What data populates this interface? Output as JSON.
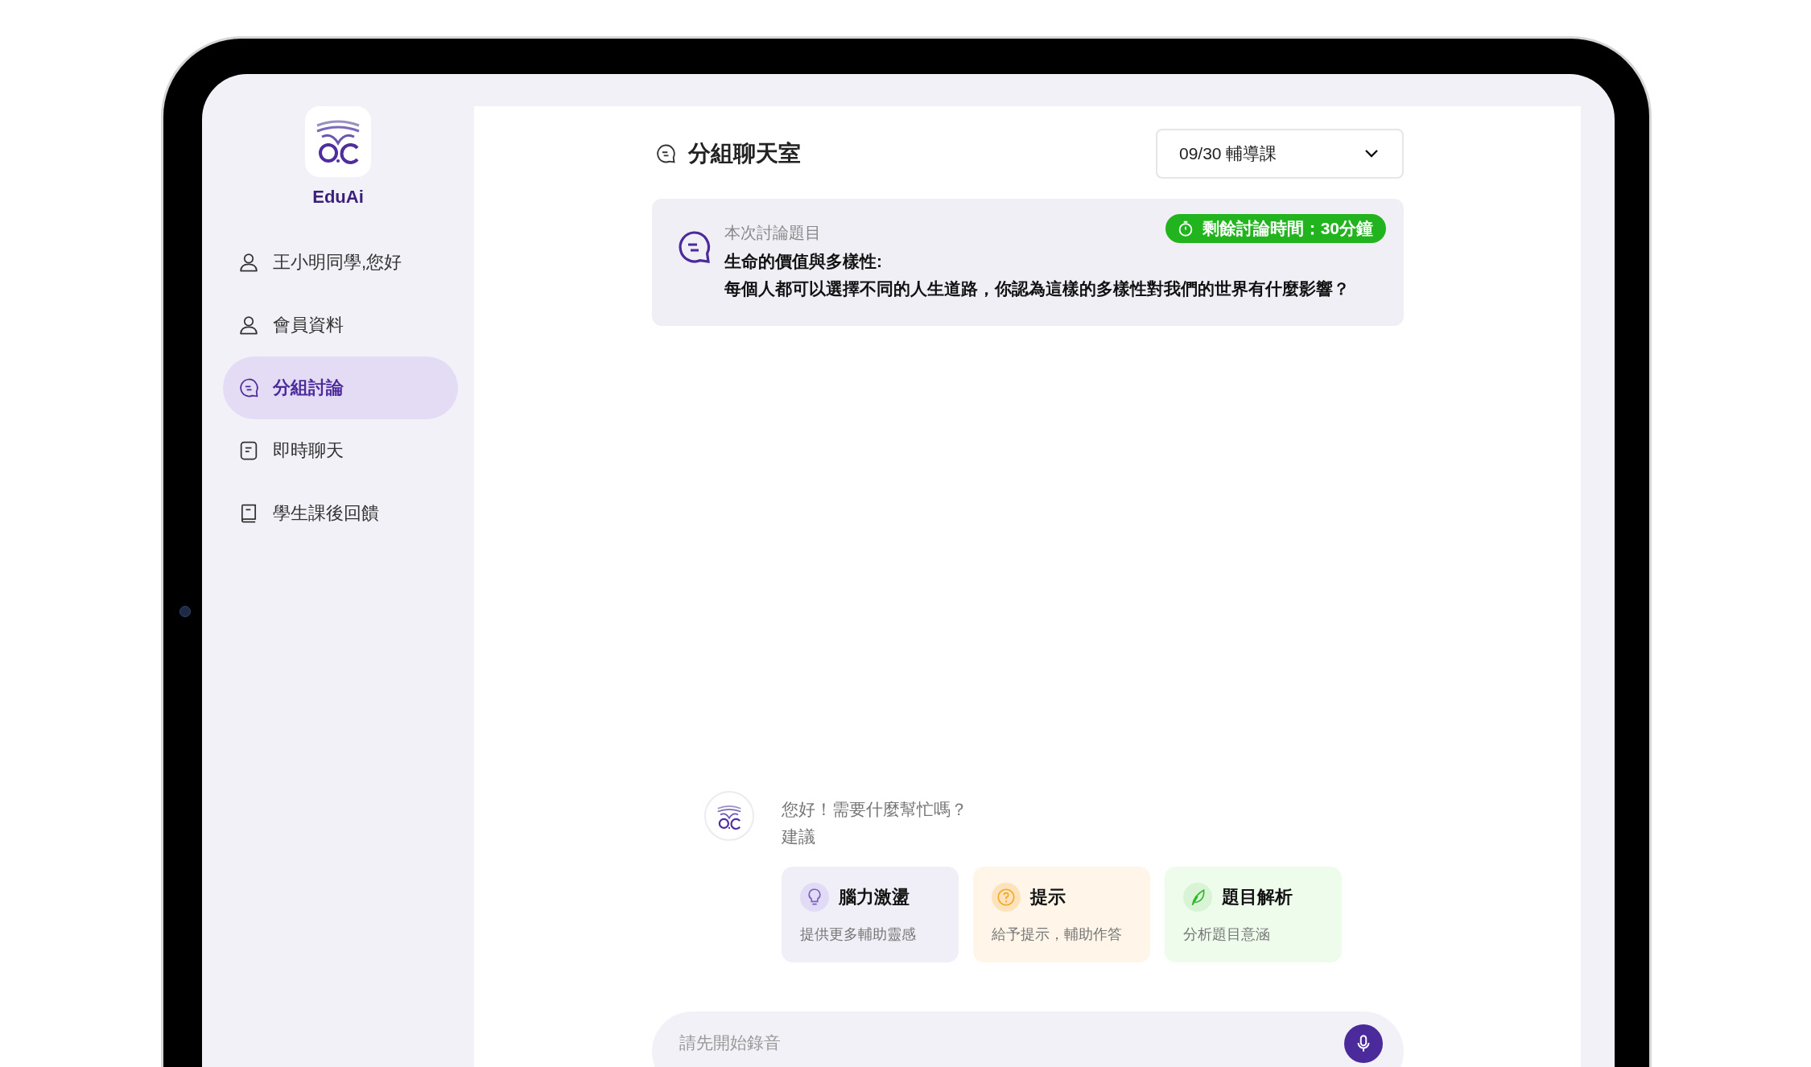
{
  "app": {
    "name": "EduAi"
  },
  "nav": [
    {
      "label": "王小明同學,您好",
      "kind": "user",
      "selected": false
    },
    {
      "label": "會員資料",
      "kind": "user",
      "selected": false
    },
    {
      "label": "分組討論",
      "kind": "chat",
      "selected": true
    },
    {
      "label": "即時聊天",
      "kind": "note",
      "selected": false
    },
    {
      "label": "學生課後回饋",
      "kind": "book",
      "selected": false
    }
  ],
  "header": {
    "title": "分組聊天室",
    "session_select": "09/30 輔導課"
  },
  "topic": {
    "label": "本次討論題目",
    "timer": "剩餘討論時間：30分鐘",
    "title": "生命的價值與多樣性:",
    "question": "每個人都可以選擇不同的人生道路，你認為這樣的多樣性對我們的世界有什麼影響？"
  },
  "assistant": {
    "greeting": "您好！需要什麼幫忙嗎？",
    "suggestions_label": "建議"
  },
  "suggestions": [
    {
      "kind": "brainstorm",
      "title": "腦力激盪",
      "description": "提供更多輔助靈感"
    },
    {
      "kind": "hint",
      "title": "提示",
      "description": "給予提示，輔助作答"
    },
    {
      "kind": "analysis",
      "title": "題目解析",
      "description": "分析題目意涵"
    }
  ],
  "composer": {
    "placeholder": "請先開始錄音"
  }
}
